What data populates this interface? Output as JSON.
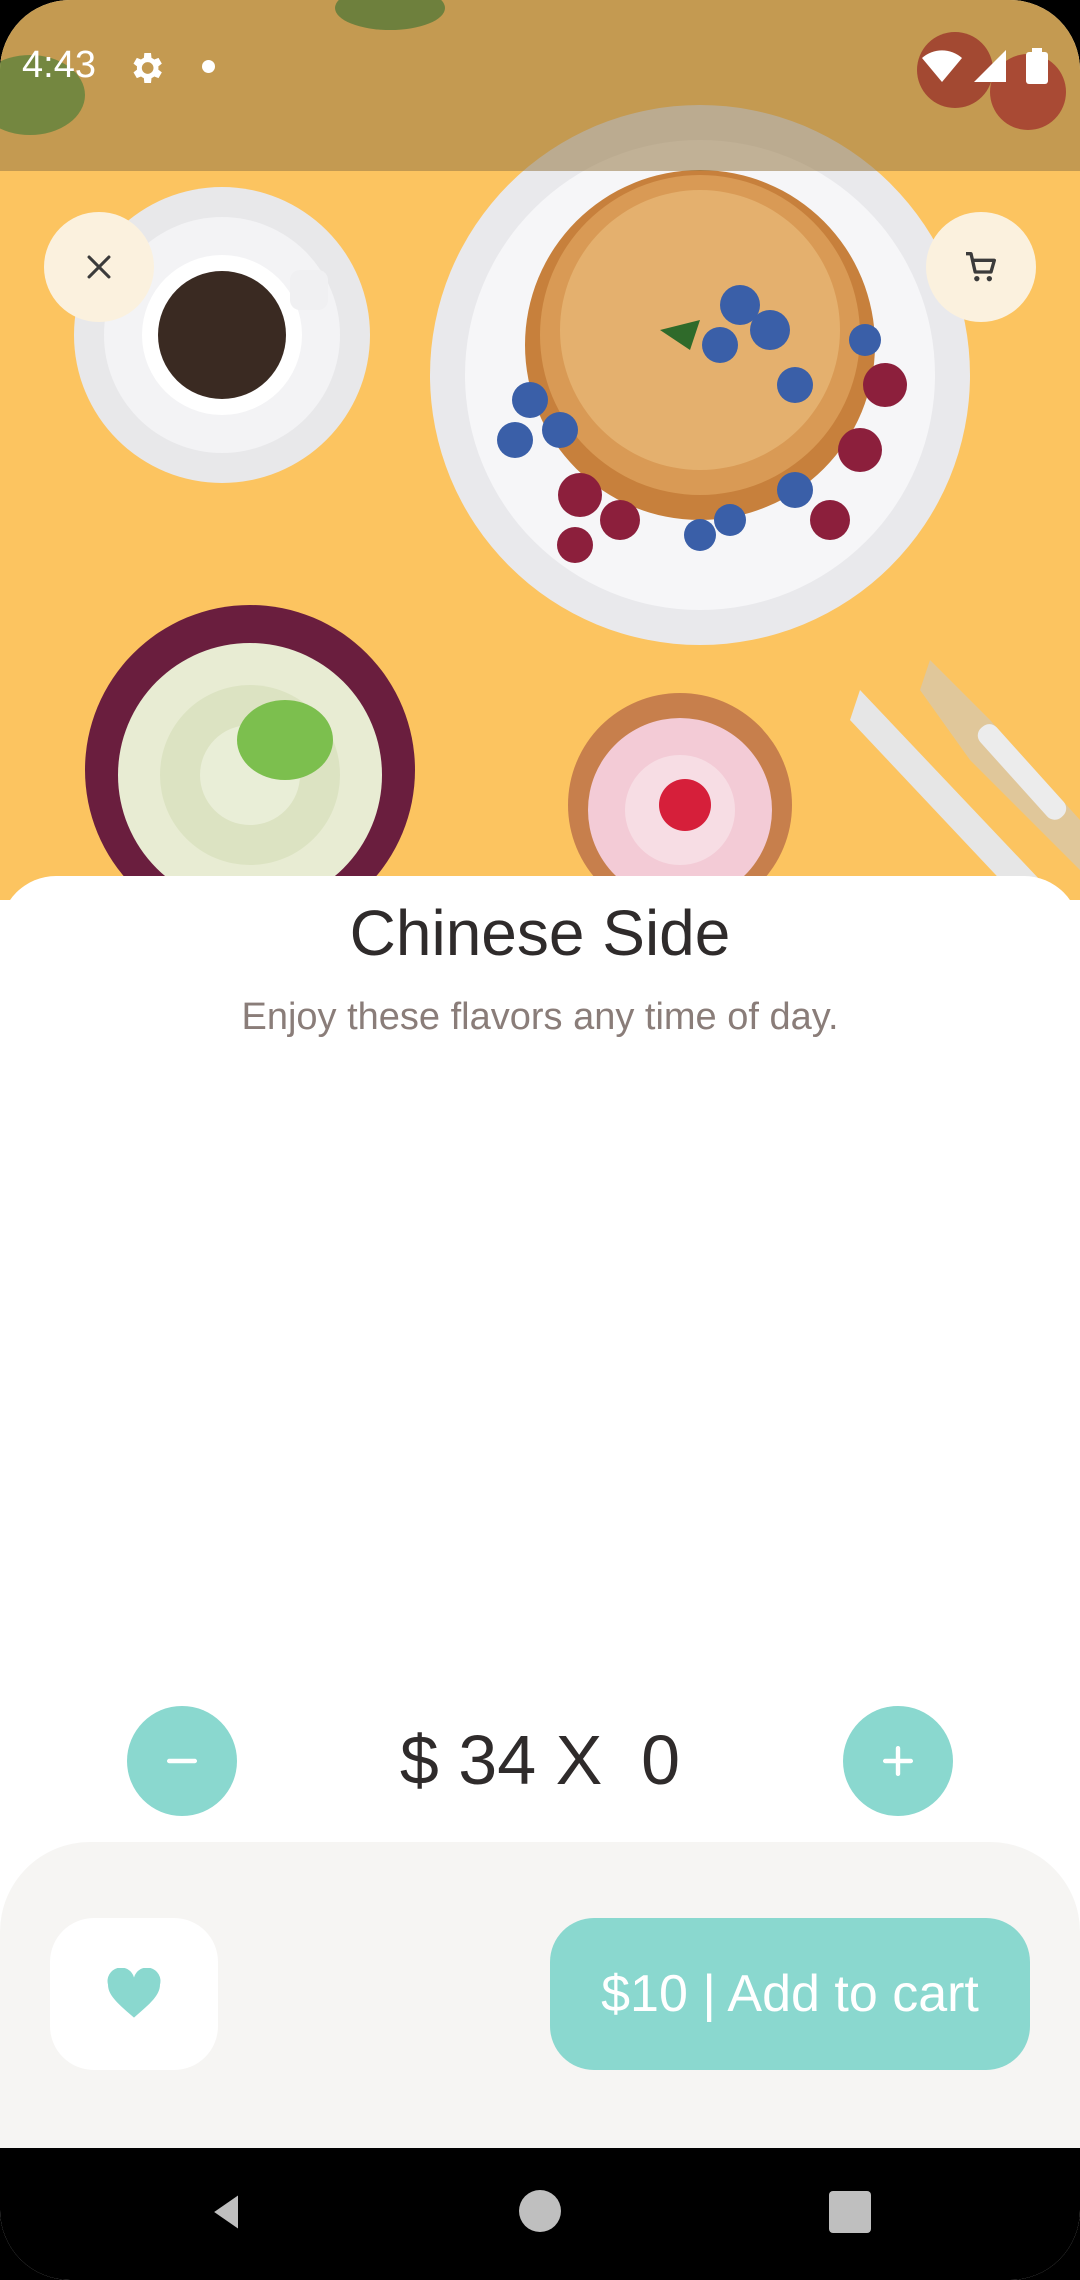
{
  "status_bar": {
    "time": "4:43"
  },
  "hero": {
    "image_name": "breakfast-flatlay-image"
  },
  "header": {
    "close_icon": "close-icon",
    "cart_icon": "cart-icon"
  },
  "product": {
    "title": "Chinese Side",
    "subtitle": "Enjoy these flavors any time of day."
  },
  "quantity": {
    "display": "$ 34 X  0",
    "minus_icon": "minus-icon",
    "plus_icon": "plus-icon"
  },
  "footer": {
    "favorite_icon": "heart-icon",
    "add_to_cart_label": "$10 | Add to cart"
  },
  "colors": {
    "accent": "#8ad8cf",
    "hero_background": "#fcc460",
    "header_button_bg": "#fbf1de",
    "footer_bg": "#f6f5f3",
    "title_text": "#2f2b2b",
    "subtitle_text": "#8a7d79"
  }
}
